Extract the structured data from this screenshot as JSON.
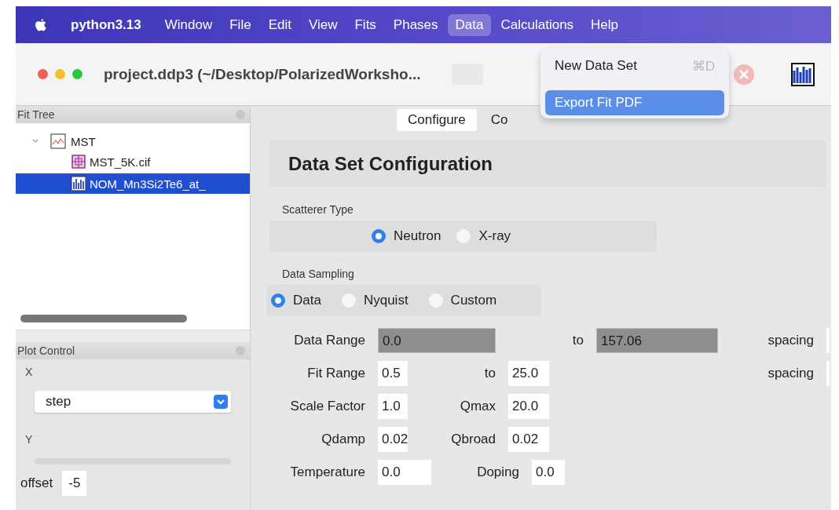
{
  "menu_bar": {
    "app": "python3.13",
    "items": [
      {
        "label": "Window",
        "selected": false
      },
      {
        "label": "File",
        "selected": false
      },
      {
        "label": "Edit",
        "selected": false
      },
      {
        "label": "View",
        "selected": false
      },
      {
        "label": "Fits",
        "selected": false
      },
      {
        "label": "Phases",
        "selected": false
      },
      {
        "label": "Data",
        "selected": true
      },
      {
        "label": "Calculations",
        "selected": false
      },
      {
        "label": "Help",
        "selected": false
      }
    ]
  },
  "window": {
    "title": "project.ddp3 (~/Desktop/PolarizedWorksho..."
  },
  "dropdown_menu": [
    {
      "label": "New Data Set",
      "shortcut": "⌘D",
      "selected": false
    },
    {
      "label": "Export Fit PDF",
      "selected": true
    }
  ],
  "fit_tree": {
    "title": "Fit Tree",
    "items": [
      {
        "label": "MST",
        "kind": "fit",
        "expanded": true,
        "selected": false,
        "children": [
          {
            "label": "MST_5K.cif",
            "kind": "phase",
            "selected": false
          },
          {
            "label": "NOM_Mn3Si2Te6_at_",
            "kind": "data",
            "selected": true
          }
        ]
      }
    ]
  },
  "plot_control": {
    "title": "Plot Control",
    "x_label": "X",
    "x_value": "step",
    "y_label": "Y",
    "offset_label": "offset",
    "offset_value": "-5"
  },
  "tabs": [
    {
      "label": "Configure",
      "selected": true
    },
    {
      "label": "Co",
      "selected": false
    }
  ],
  "config": {
    "title": "Data Set Configuration",
    "scatterer": {
      "label": "Scatterer Type",
      "options": [
        {
          "label": "Neutron",
          "selected": true
        },
        {
          "label": "X-ray",
          "selected": false
        }
      ]
    },
    "sampling": {
      "label": "Data Sampling",
      "options": [
        {
          "label": "Data",
          "selected": true
        },
        {
          "label": "Nyquist",
          "selected": false
        },
        {
          "label": "Custom",
          "selected": false
        }
      ]
    },
    "rows": [
      {
        "label": "Data Range",
        "value": "0.0",
        "disabled": true,
        "label2": "to",
        "value2": "157.06",
        "spacing": "spacing"
      },
      {
        "label": "Fit Range",
        "value": "0.5",
        "disabled": false,
        "label2": "to",
        "value2": "25.0",
        "spacing": "spacing"
      },
      {
        "label": "Scale Factor",
        "value": "1.0",
        "disabled": false,
        "label2": "Qmax",
        "value2": "20.0"
      },
      {
        "label": "Qdamp",
        "value": "0.02",
        "disabled": false,
        "label2": "Qbroad",
        "value2": "0.02"
      },
      {
        "label": "Temperature",
        "value": "0.0",
        "disabled": false,
        "label2": "Doping",
        "value2": "0.0"
      }
    ]
  }
}
